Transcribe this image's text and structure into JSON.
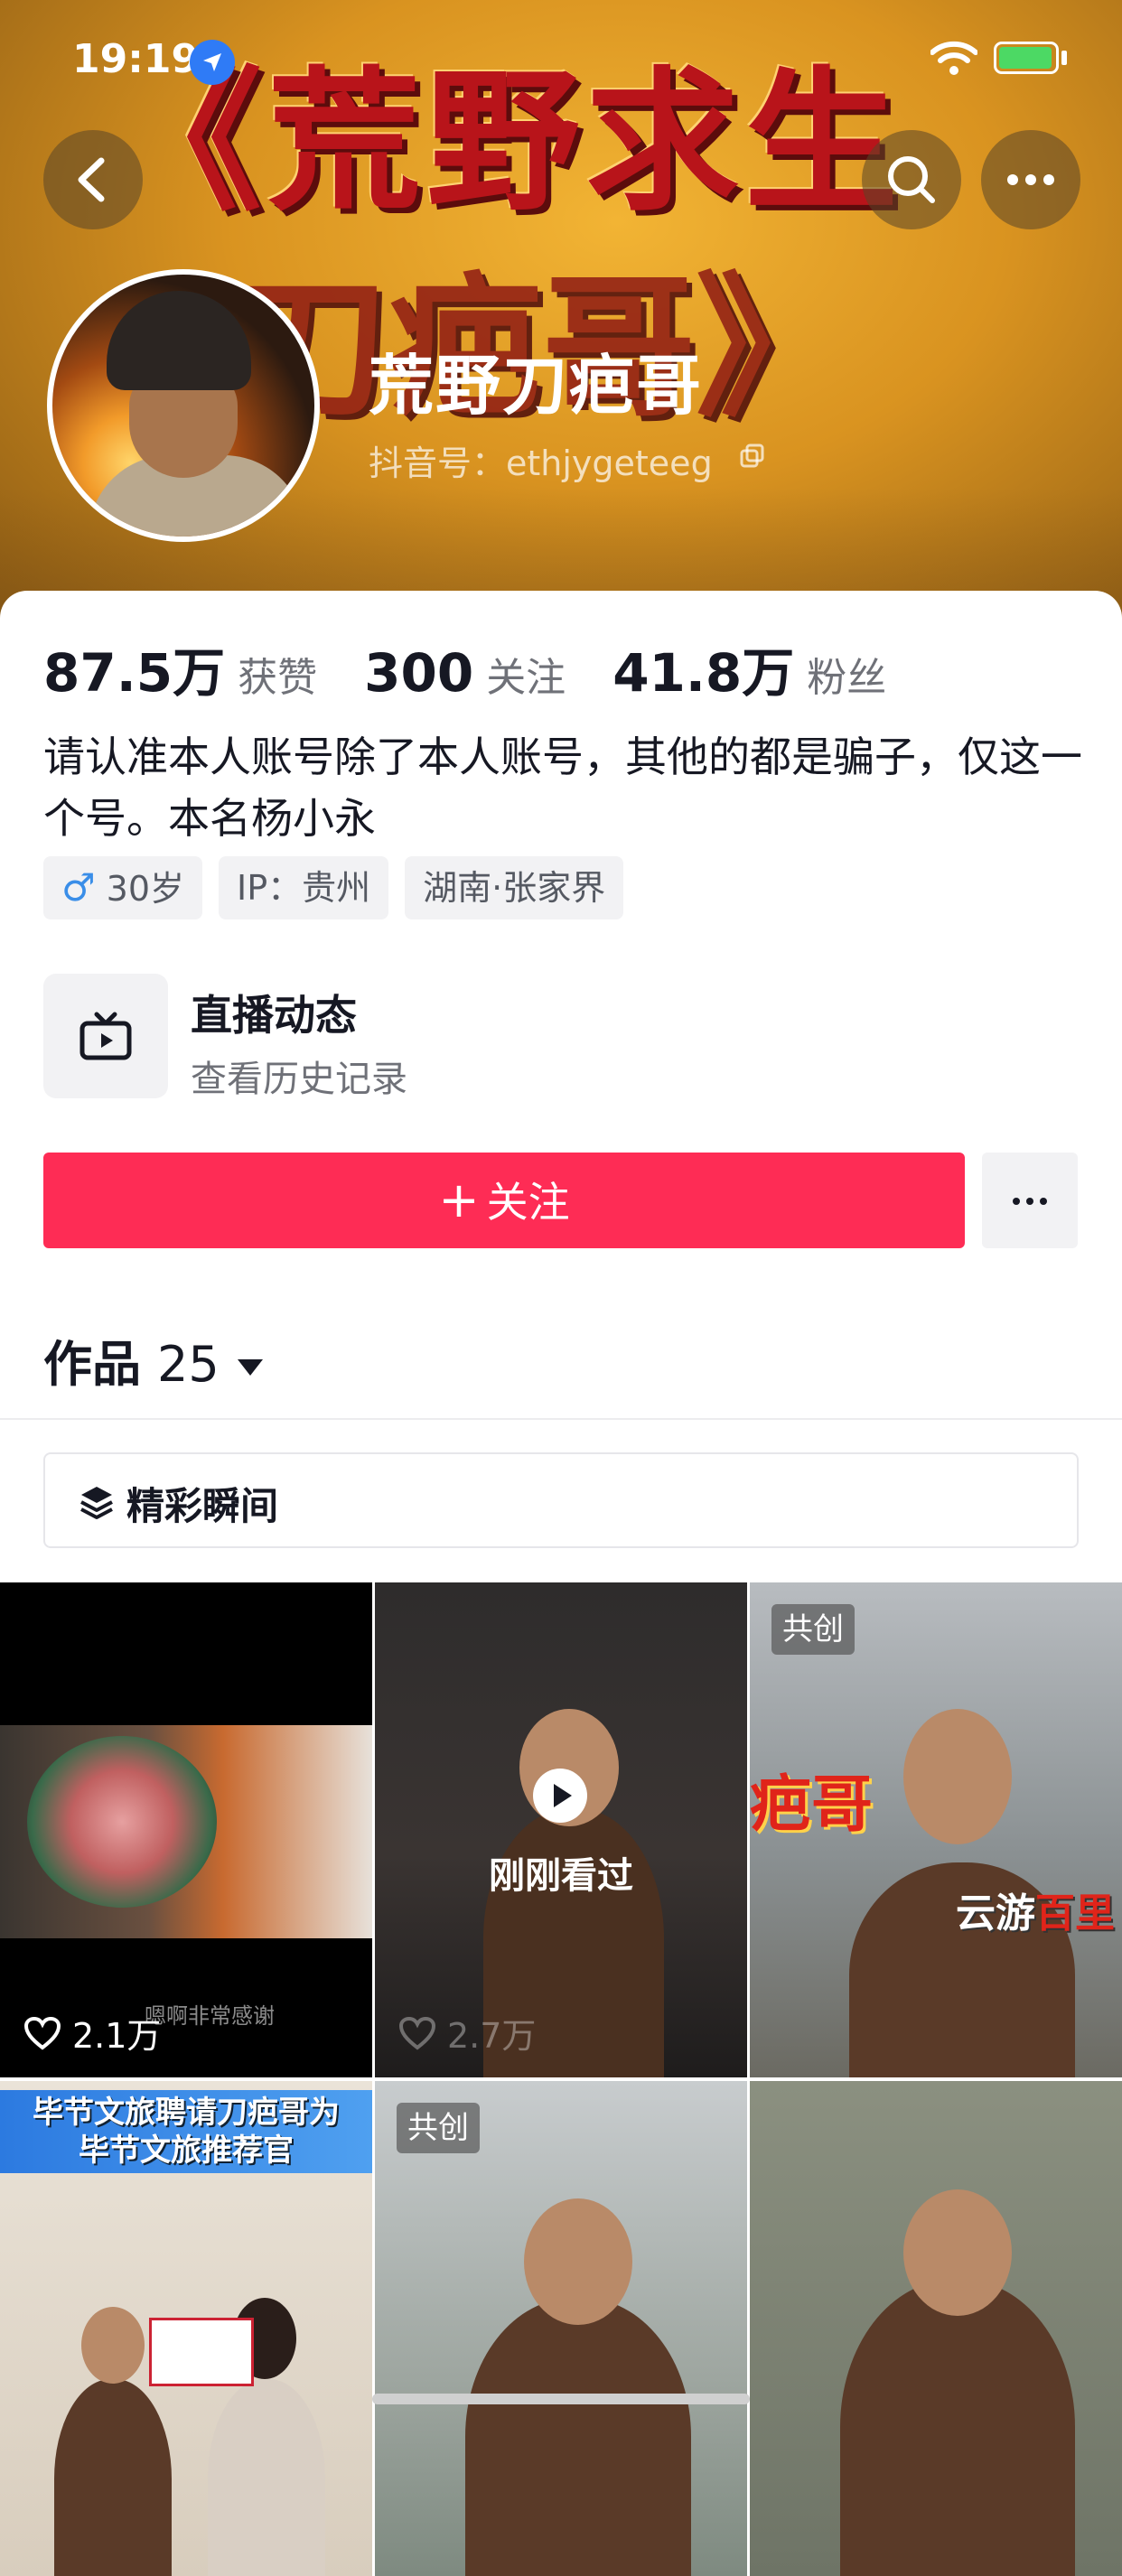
{
  "status_bar": {
    "time": "19:19"
  },
  "banner": {
    "title_line1": "《荒野求生",
    "title_line2": "刀疤哥》",
    "nickname": "荒野刀疤哥",
    "douyin_id": "抖音号：ethjygeteeg"
  },
  "stats": [
    {
      "value": "87.5万",
      "label": "获赞"
    },
    {
      "value": "300",
      "label": "关注"
    },
    {
      "value": "41.8万",
      "label": "粉丝"
    }
  ],
  "bio": "请认准本人账号除了本人账号，其他的都是骗子，仅这一个号。本名杨小永",
  "tags": {
    "gender_symbol": "♂",
    "age": "30岁",
    "ip": "IP：贵州",
    "location": "湖南·张家界"
  },
  "live": {
    "title": "直播动态",
    "subtitle": "查看历史记录"
  },
  "follow_button": {
    "plus": "+",
    "label": "关注"
  },
  "works": {
    "label": "作品",
    "count": "25"
  },
  "highlights": {
    "label": "精彩瞬间"
  },
  "videos": [
    {
      "likes": "2.1万",
      "caption": "嗯啊非常感谢"
    },
    {
      "likes": "2.7万",
      "status": "刚刚看过"
    },
    {
      "badge": "共创",
      "overlay_left": "疤哥",
      "overlay_right_a": "云游",
      "overlay_right_b": "百里"
    },
    {
      "banner_text_1": "毕节文旅聘请刀疤哥为",
      "banner_text_2": "毕节文旅推荐官"
    },
    {
      "badge": "共创"
    },
    {}
  ],
  "colors": {
    "accent": "#fe2c55",
    "male": "#3a8ee8",
    "location_badge": "#2f7bf6"
  }
}
